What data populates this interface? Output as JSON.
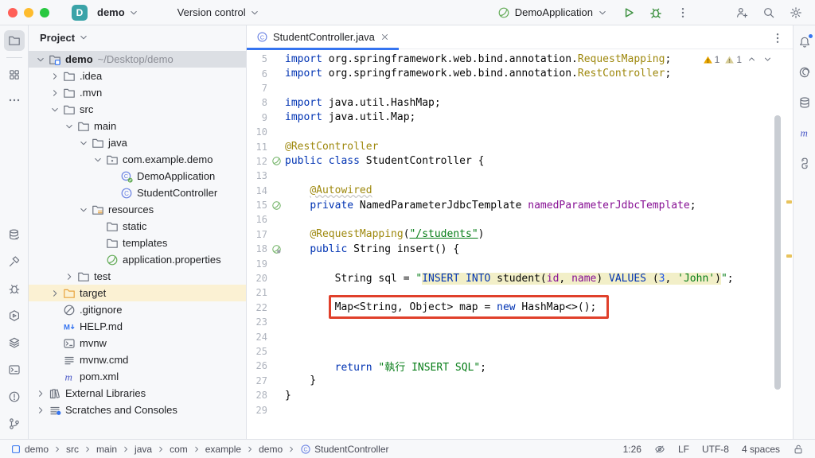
{
  "titlebar": {
    "project_name": "demo",
    "vcs_label": "Version control",
    "run_config": "DemoApplication",
    "avatar_letter": "D"
  },
  "colors": {
    "accent_blue": "#3574F0",
    "run_green": "#3E9141",
    "spring_green": "#67AD5B",
    "warning_amber": "#EBA700",
    "red_box": "#E0402B",
    "avatar_teal": "#3AA3A8"
  },
  "left_stripe": {
    "top": [
      {
        "icon": "folder",
        "name": "project-tool",
        "selected": true
      },
      {
        "icon": "divider",
        "name": "divider"
      },
      {
        "icon": "structure",
        "name": "structure-tool"
      },
      {
        "icon": "more",
        "name": "more-tools"
      }
    ],
    "bottom": [
      {
        "icon": "db-check",
        "name": "database-tool"
      },
      {
        "icon": "hammer",
        "name": "build-tool"
      },
      {
        "icon": "bug-tool",
        "name": "debug-tool"
      },
      {
        "icon": "services",
        "name": "services-tool"
      },
      {
        "icon": "layers",
        "name": "layers-tool"
      },
      {
        "icon": "terminal",
        "name": "terminal-tool"
      },
      {
        "icon": "problems",
        "name": "problems-tool"
      },
      {
        "icon": "git",
        "name": "git-tool"
      }
    ]
  },
  "right_stripe": [
    {
      "icon": "bell",
      "name": "notifications",
      "badge": true
    },
    {
      "icon": "ai",
      "name": "ai-assistant"
    },
    {
      "icon": "db",
      "name": "database-tool-right"
    },
    {
      "icon": "maven",
      "name": "maven-tool"
    },
    {
      "icon": "python",
      "name": "python-packages-tool"
    }
  ],
  "project_panel": {
    "title": "Project",
    "items": [
      {
        "label": "demo",
        "extra": "~/Desktop/demo",
        "icon": "project-folder",
        "level": 0,
        "chevron": "open",
        "state": "selected",
        "bold": true
      },
      {
        "label": ".idea",
        "icon": "folder",
        "level": 1,
        "chevron": "closed"
      },
      {
        "label": ".mvn",
        "icon": "folder",
        "level": 1,
        "chevron": "closed"
      },
      {
        "label": "src",
        "icon": "folder",
        "level": 1,
        "chevron": "open"
      },
      {
        "label": "main",
        "icon": "folder",
        "level": 2,
        "chevron": "open"
      },
      {
        "label": "java",
        "icon": "folder",
        "level": 3,
        "chevron": "open"
      },
      {
        "label": "com.example.demo",
        "icon": "package",
        "level": 4,
        "chevron": "open"
      },
      {
        "label": "DemoApplication",
        "icon": "class-spring",
        "level": 5
      },
      {
        "label": "StudentController",
        "icon": "class",
        "level": 5
      },
      {
        "label": "resources",
        "icon": "folder-resources",
        "level": 3,
        "chevron": "open"
      },
      {
        "label": "static",
        "icon": "folder",
        "level": 4
      },
      {
        "label": "templates",
        "icon": "folder",
        "level": 4
      },
      {
        "label": "application.properties",
        "icon": "spring-leaf",
        "level": 4
      },
      {
        "label": "test",
        "icon": "folder",
        "level": 2,
        "chevron": "closed"
      },
      {
        "label": "target",
        "icon": "folder-excluded",
        "level": 1,
        "chevron": "closed",
        "state": "highlighted"
      },
      {
        "label": ".gitignore",
        "icon": "ignored",
        "level": 1
      },
      {
        "label": "HELP.md",
        "icon": "markdown",
        "level": 1
      },
      {
        "label": "mvnw",
        "icon": "shell",
        "level": 1
      },
      {
        "label": "mvnw.cmd",
        "icon": "textfile",
        "level": 1
      },
      {
        "label": "pom.xml",
        "icon": "maven",
        "level": 1
      },
      {
        "label": "External Libraries",
        "icon": "libraries",
        "level": 0,
        "chevron": "closed"
      },
      {
        "label": "Scratches and Consoles",
        "icon": "scratches",
        "level": 0,
        "chevron": "closed"
      }
    ]
  },
  "editor": {
    "tab": {
      "label": "StudentController.java"
    },
    "inspections": {
      "warnings": "1",
      "weak_warnings": "1"
    },
    "lines": [
      {
        "n": 5,
        "tokens": [
          {
            "c": "k",
            "t": "import"
          },
          {
            "c": "p",
            "t": " org.springframework.web.bind.annotation."
          },
          {
            "c": "a",
            "t": "RequestMapping"
          },
          {
            "c": "p",
            "t": ";"
          }
        ]
      },
      {
        "n": 6,
        "tokens": [
          {
            "c": "k",
            "t": "import"
          },
          {
            "c": "p",
            "t": " org.springframework.web.bind.annotation."
          },
          {
            "c": "a",
            "t": "RestController"
          },
          {
            "c": "p",
            "t": ";"
          }
        ]
      },
      {
        "n": 7,
        "tokens": []
      },
      {
        "n": 8,
        "tokens": [
          {
            "c": "k",
            "t": "import"
          },
          {
            "c": "p",
            "t": " java.util.HashMap;"
          }
        ]
      },
      {
        "n": 9,
        "tokens": [
          {
            "c": "k",
            "t": "import"
          },
          {
            "c": "p",
            "t": " java.util.Map;"
          }
        ]
      },
      {
        "n": 10,
        "tokens": []
      },
      {
        "n": 11,
        "tokens": [
          {
            "c": "a",
            "t": "@RestController"
          }
        ]
      },
      {
        "n": 12,
        "g": "spring-bean",
        "tokens": [
          {
            "c": "k",
            "t": "public"
          },
          {
            "c": "p",
            "t": " "
          },
          {
            "c": "k",
            "t": "class"
          },
          {
            "c": "p",
            "t": " StudentController {"
          }
        ]
      },
      {
        "n": 13,
        "tokens": []
      },
      {
        "n": 14,
        "tokens": [
          {
            "c": "p",
            "t": "    "
          },
          {
            "c": "aw",
            "t": "@Autowired"
          }
        ]
      },
      {
        "n": 15,
        "g": "spring-bean",
        "tokens": [
          {
            "c": "p",
            "t": "    "
          },
          {
            "c": "k",
            "t": "private"
          },
          {
            "c": "p",
            "t": " NamedParameterJdbcTemplate "
          },
          {
            "c": "f",
            "t": "namedParameterJdbcTemplate"
          },
          {
            "c": "p",
            "t": ";"
          }
        ]
      },
      {
        "n": 16,
        "tokens": []
      },
      {
        "n": 17,
        "tokens": [
          {
            "c": "p",
            "t": "    "
          },
          {
            "c": "a",
            "t": "@RequestMapping"
          },
          {
            "c": "p",
            "t": "("
          },
          {
            "c": "su",
            "t": "\"/students\""
          },
          {
            "c": "p",
            "t": ")"
          }
        ]
      },
      {
        "n": 18,
        "g": "request-mapping",
        "tokens": [
          {
            "c": "p",
            "t": "    "
          },
          {
            "c": "k",
            "t": "public"
          },
          {
            "c": "p",
            "t": " String insert() {"
          }
        ]
      },
      {
        "n": 19,
        "tokens": []
      },
      {
        "n": 20,
        "tokens": [
          {
            "c": "p",
            "t": "        String sql = "
          },
          {
            "c": "s",
            "t": "\""
          },
          {
            "c": "qk",
            "t": "INSERT INTO"
          },
          {
            "c": "qp",
            "t": " student("
          },
          {
            "c": "qf",
            "t": "id"
          },
          {
            "c": "qp",
            "t": ", "
          },
          {
            "c": "qf",
            "t": "name"
          },
          {
            "c": "qp",
            "t": ") "
          },
          {
            "c": "qk",
            "t": "VALUES"
          },
          {
            "c": "qp",
            "t": " ("
          },
          {
            "c": "qn",
            "t": "3"
          },
          {
            "c": "qp",
            "t": ", "
          },
          {
            "c": "qs",
            "t": "'John'"
          },
          {
            "c": "qp",
            "t": ")"
          },
          {
            "c": "s",
            "t": "\""
          },
          {
            "c": "p",
            "t": ";"
          }
        ]
      },
      {
        "n": 21,
        "tokens": []
      },
      {
        "n": 22,
        "tokens": [
          {
            "c": "p",
            "t": "        "
          },
          {
            "c": "p",
            "t": "Map<String, Object> map = "
          },
          {
            "c": "k",
            "t": "new"
          },
          {
            "c": "p",
            "t": " HashMap<>();"
          }
        ]
      },
      {
        "n": 23,
        "tokens": []
      },
      {
        "n": 24,
        "tokens": []
      },
      {
        "n": 25,
        "tokens": []
      },
      {
        "n": 26,
        "tokens": [
          {
            "c": "p",
            "t": "        "
          },
          {
            "c": "k",
            "t": "return"
          },
          {
            "c": "p",
            "t": " "
          },
          {
            "c": "s",
            "t": "\"執行 INSERT SQL\""
          },
          {
            "c": "p",
            "t": ";"
          }
        ]
      },
      {
        "n": 27,
        "tokens": [
          {
            "c": "p",
            "t": "    }"
          }
        ]
      },
      {
        "n": 28,
        "tokens": [
          {
            "c": "p",
            "t": "}"
          }
        ]
      },
      {
        "n": 29,
        "tokens": []
      }
    ]
  },
  "breadcrumbs": {
    "items": [
      {
        "label": "demo",
        "icon": "module-square"
      },
      {
        "label": "src"
      },
      {
        "label": "main"
      },
      {
        "label": "java"
      },
      {
        "label": "com"
      },
      {
        "label": "example"
      },
      {
        "label": "demo"
      },
      {
        "label": "StudentController",
        "icon": "class"
      }
    ]
  },
  "statusbar": {
    "caret": "1:26",
    "line_ending": "LF",
    "encoding": "UTF-8",
    "indent": "4 spaces"
  }
}
